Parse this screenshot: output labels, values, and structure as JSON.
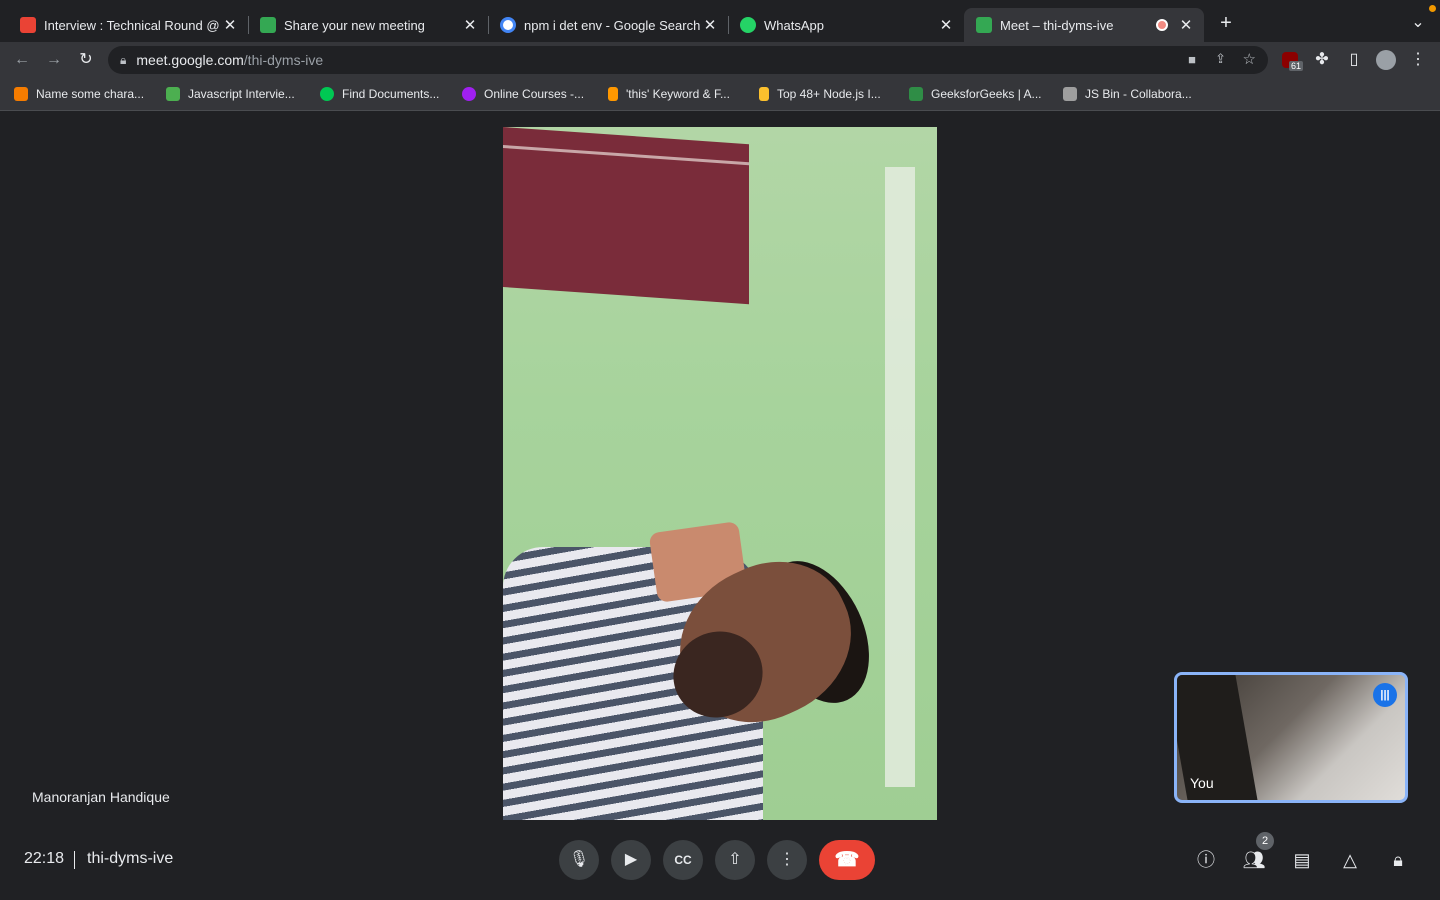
{
  "tabs": [
    {
      "title": "Interview : Technical Round @",
      "favicon": "gmail-icon",
      "color": "#ea4335"
    },
    {
      "title": "Share your new meeting",
      "favicon": "meet-icon",
      "color": "#34a853"
    },
    {
      "title": "npm i det env - Google Search",
      "favicon": "google-icon",
      "color": "#4285f4"
    },
    {
      "title": "WhatsApp",
      "favicon": "whatsapp-icon",
      "color": "#25d366"
    },
    {
      "title": "Meet – thi-dyms-ive",
      "favicon": "meet-icon",
      "color": "#34a853",
      "active": true
    }
  ],
  "address": {
    "host": "meet.google.com",
    "path": "/thi-dyms-ive"
  },
  "extension_badge": "61",
  "bookmarks": [
    {
      "label": "Name some chara...",
      "color": "#f57c00"
    },
    {
      "label": "Javascript Intervie...",
      "color": "#4caf50"
    },
    {
      "label": "Find Documents...",
      "color": "#00c853"
    },
    {
      "label": "Online Courses -...",
      "color": "#a020f0"
    },
    {
      "label": "'this' Keyword & F...",
      "color": "#ff9800"
    },
    {
      "label": "Top 48+ Node.js I...",
      "color": "#fbc02d"
    },
    {
      "label": "GeeksforGeeks | A...",
      "color": "#2f8d46"
    },
    {
      "label": "JS Bin - Collabora...",
      "color": "#9e9e9e"
    }
  ],
  "meeting": {
    "participant_name": "Manoranjan Handique",
    "self_label": "You",
    "time": "22:18",
    "code": "thi-dyms-ive",
    "participant_count": "2"
  }
}
